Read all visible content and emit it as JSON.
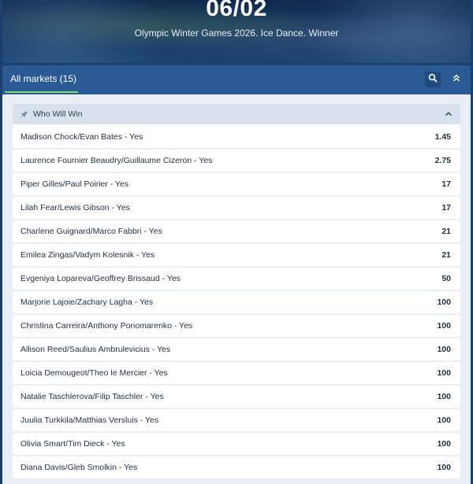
{
  "event": {
    "date": "06/02",
    "title": "Olympic Winter Games 2026. Ice Dance. Winner"
  },
  "tabs": {
    "all_markets_label": "All markets (15)"
  },
  "icons": {
    "search": "search-icon",
    "collapse": "double-chevron-up-icon",
    "pin": "pin-icon",
    "group_toggle": "chevron-up-icon"
  },
  "colors": {
    "accent_underline": "#7fd27a",
    "tabbar_bg": "#2a5a93",
    "group_header_bg": "#d9e1ec"
  },
  "market": {
    "title": "Who Will Win",
    "selections": [
      {
        "name": "Madison Chock/Evan Bates - Yes",
        "odds": "1.45"
      },
      {
        "name": "Laurence Fournier Beaudry/Guillaume Cizeron - Yes",
        "odds": "2.75"
      },
      {
        "name": "Piper Gilles/Paul Poirier - Yes",
        "odds": "17"
      },
      {
        "name": "Lilah Fear/Lewis Gibson - Yes",
        "odds": "17"
      },
      {
        "name": "Charlene Guignard/Marco Fabbri - Yes",
        "odds": "21"
      },
      {
        "name": "Emilea Zingas/Vadym Kolesnik - Yes",
        "odds": "21"
      },
      {
        "name": "Evgeniya Lopareva/Geoffrey Brissaud - Yes",
        "odds": "50"
      },
      {
        "name": "Marjorie Lajoie/Zachary Lagha - Yes",
        "odds": "100"
      },
      {
        "name": "Christina Carreira/Anthony Ponomarenko - Yes",
        "odds": "100"
      },
      {
        "name": "Allison Reed/Saulius Ambrulevicius - Yes",
        "odds": "100"
      },
      {
        "name": "Loicia Demougeot/Theo le Mercier - Yes",
        "odds": "100"
      },
      {
        "name": "Natalie Taschlerova/Filip Taschler - Yes",
        "odds": "100"
      },
      {
        "name": "Juulia Turkkila/Matthias Versluis - Yes",
        "odds": "100"
      },
      {
        "name": "Olivia Smart/Tim Dieck - Yes",
        "odds": "100"
      },
      {
        "name": "Diana Davis/Gleb Smolkin - Yes",
        "odds": "100"
      }
    ]
  }
}
